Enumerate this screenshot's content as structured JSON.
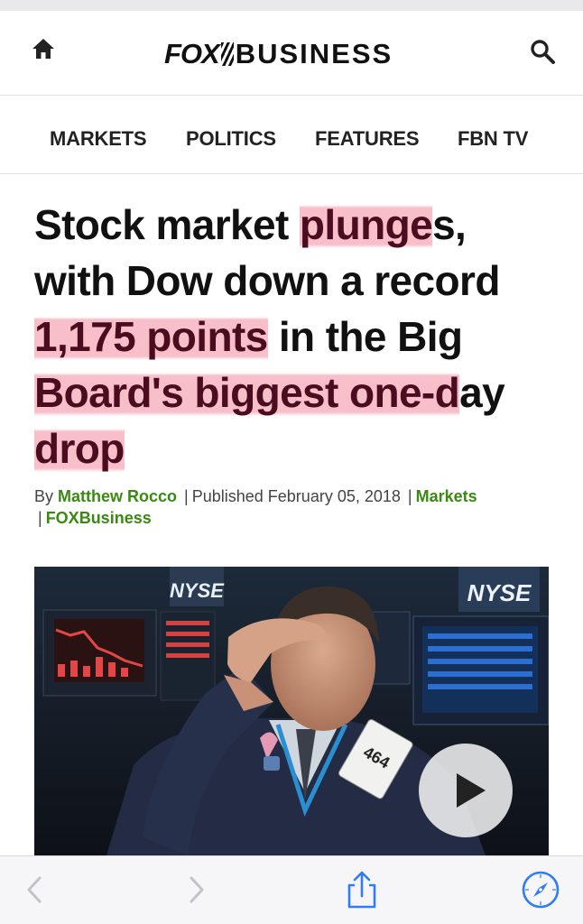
{
  "header": {
    "brand_left": "FOX",
    "brand_right": "BUSINESS"
  },
  "nav": {
    "items": [
      "MARKETS",
      "POLITICS",
      "FEATURES",
      "FBN TV"
    ]
  },
  "article": {
    "headline": {
      "l1_hl": "plunge",
      "l1_pre": "Stock market ",
      "l1_post": "s,",
      "l2": "with Dow down a record",
      "l3_hl": "1,175 points",
      "l3_post": " in the Big",
      "l4_hl": "Board's biggest one-d",
      "l4_post": "ay",
      "l5_hl": "drop"
    },
    "byline": {
      "by": "By",
      "author": "Matthew Rocco",
      "published": "Published February 05, 2018",
      "section": "Markets",
      "source": "FOXBusiness"
    },
    "hero_image": {
      "signs": [
        "NYSE",
        "NYSE"
      ],
      "badge_number": "464"
    }
  },
  "icons": {
    "home": "home-icon",
    "search": "search-icon",
    "play": "play-icon",
    "back": "chevron-left-icon",
    "forward": "chevron-right-icon",
    "share": "share-icon",
    "safari": "compass-icon"
  },
  "colors": {
    "link_green": "#3a8a12",
    "highlight_pink": "#f5aab9",
    "text": "#111111"
  }
}
